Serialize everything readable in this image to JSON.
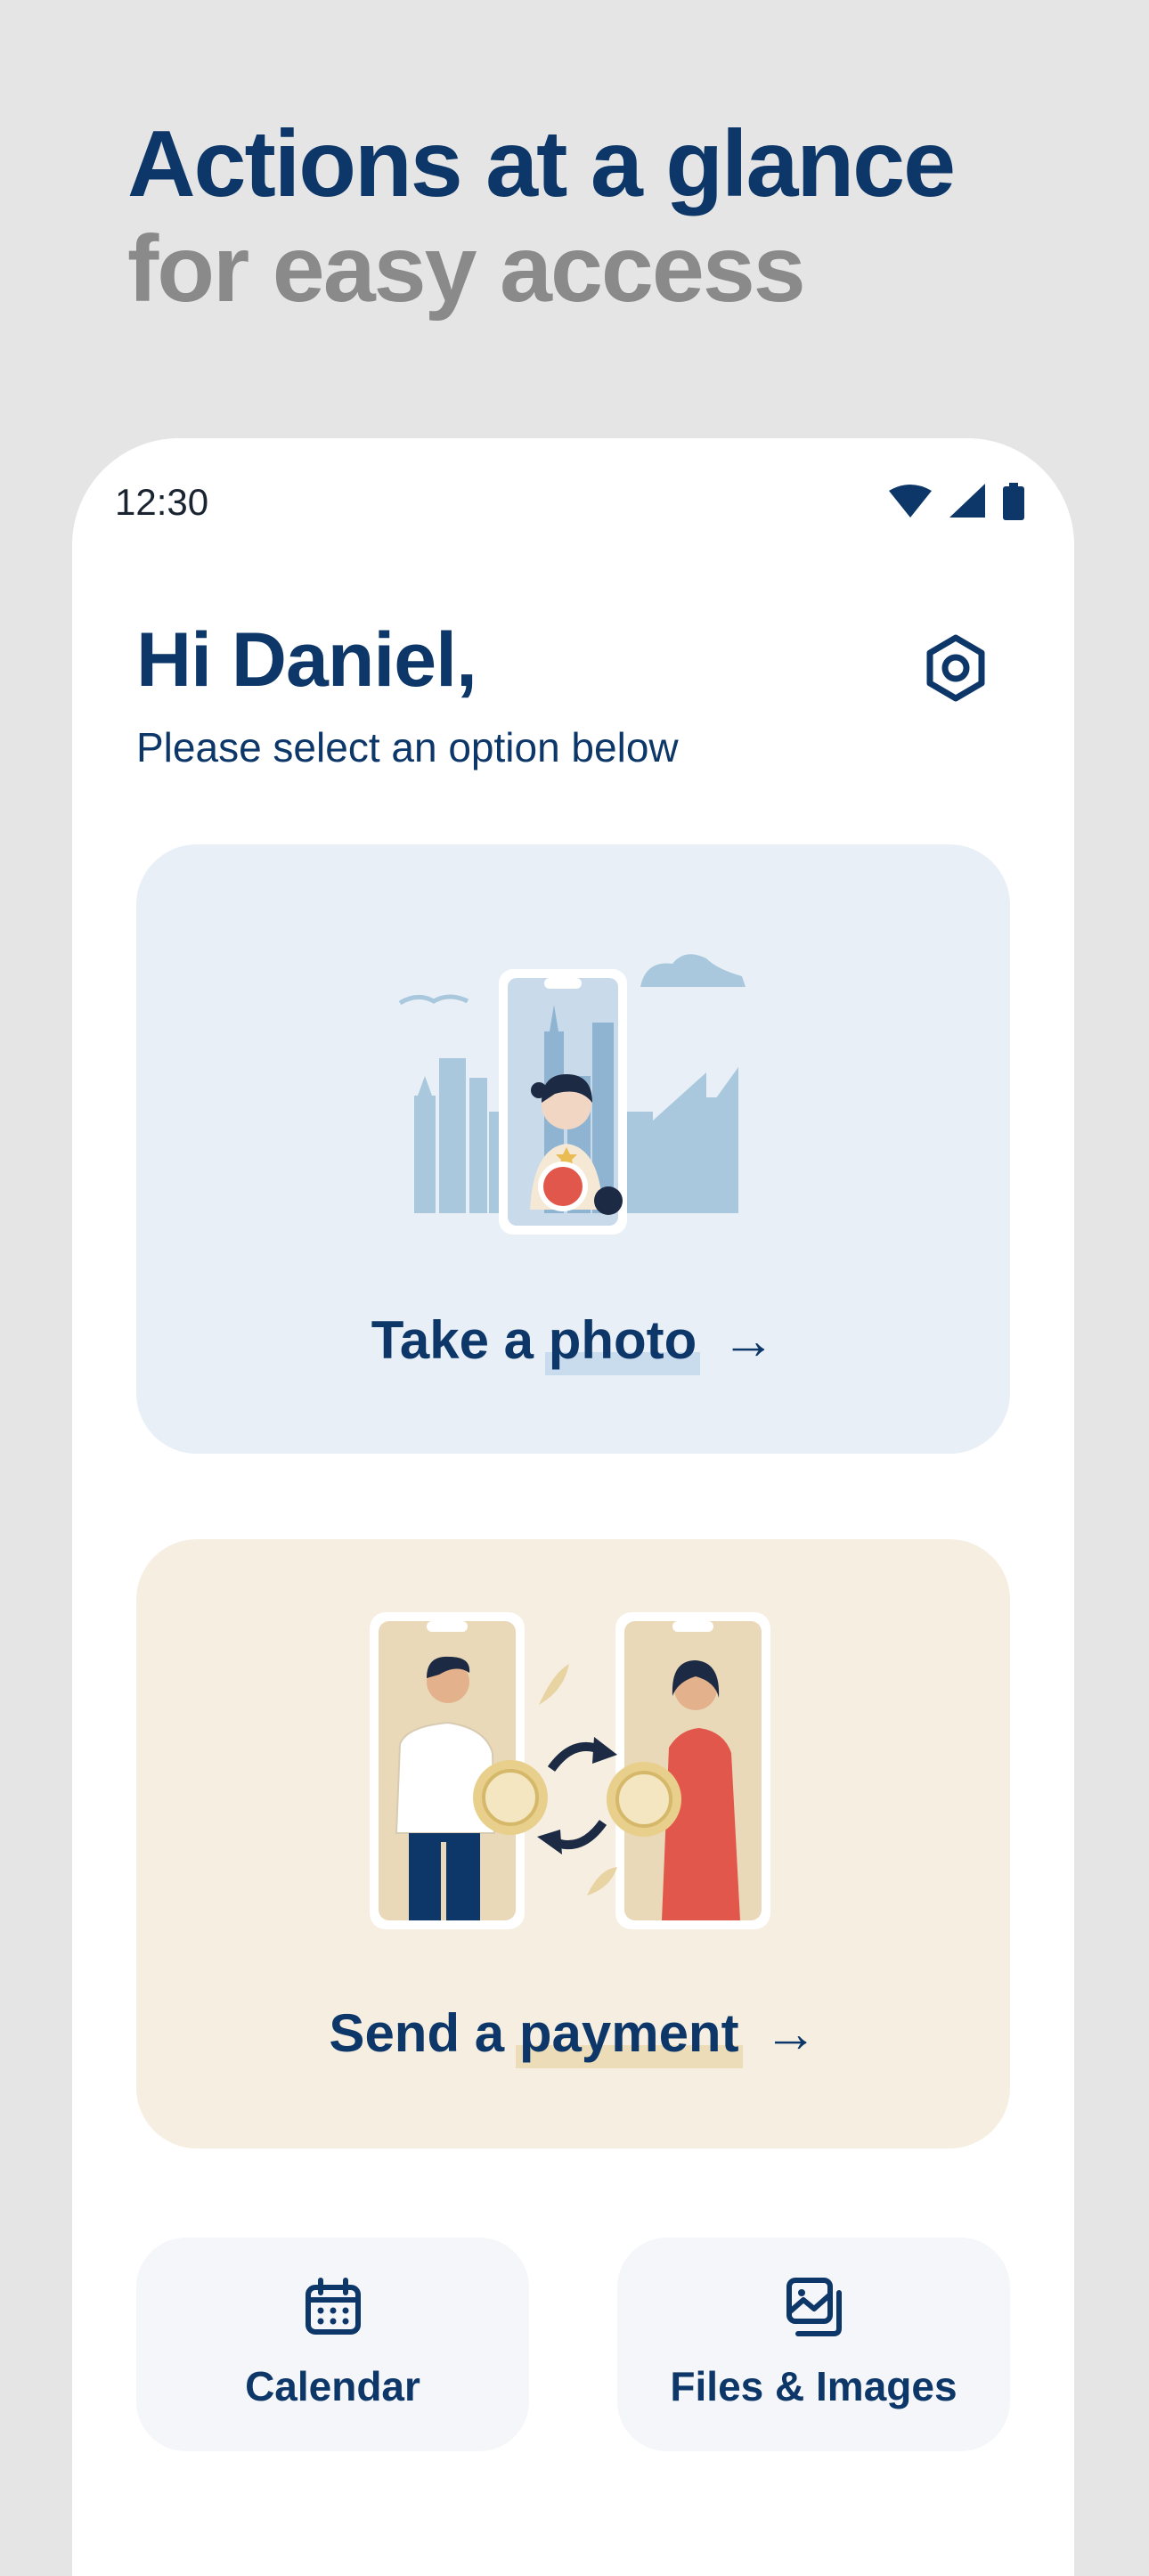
{
  "headline": {
    "line1": "Actions at a glance",
    "line2": "for easy access"
  },
  "status_bar": {
    "time": "12:30",
    "icons": [
      "wifi-icon",
      "signal-icon",
      "battery-icon"
    ]
  },
  "greeting": {
    "title": "Hi Daniel,",
    "subtitle": "Please select an option below"
  },
  "cards": {
    "photo": {
      "label_pre": "Take a ",
      "label_hl": "photo",
      "arrow": "→"
    },
    "payment": {
      "label_pre": "Send a ",
      "label_hl": "payment",
      "arrow": "→"
    }
  },
  "tiles": {
    "calendar": {
      "label": "Calendar",
      "icon": "calendar-icon"
    },
    "files": {
      "label": "Files & Images",
      "icon": "images-icon"
    }
  },
  "colors": {
    "brand_navy": "#0d3768",
    "photo_card": "#e8eff7",
    "payment_card": "#f6efe1",
    "record": "#e2574c"
  }
}
